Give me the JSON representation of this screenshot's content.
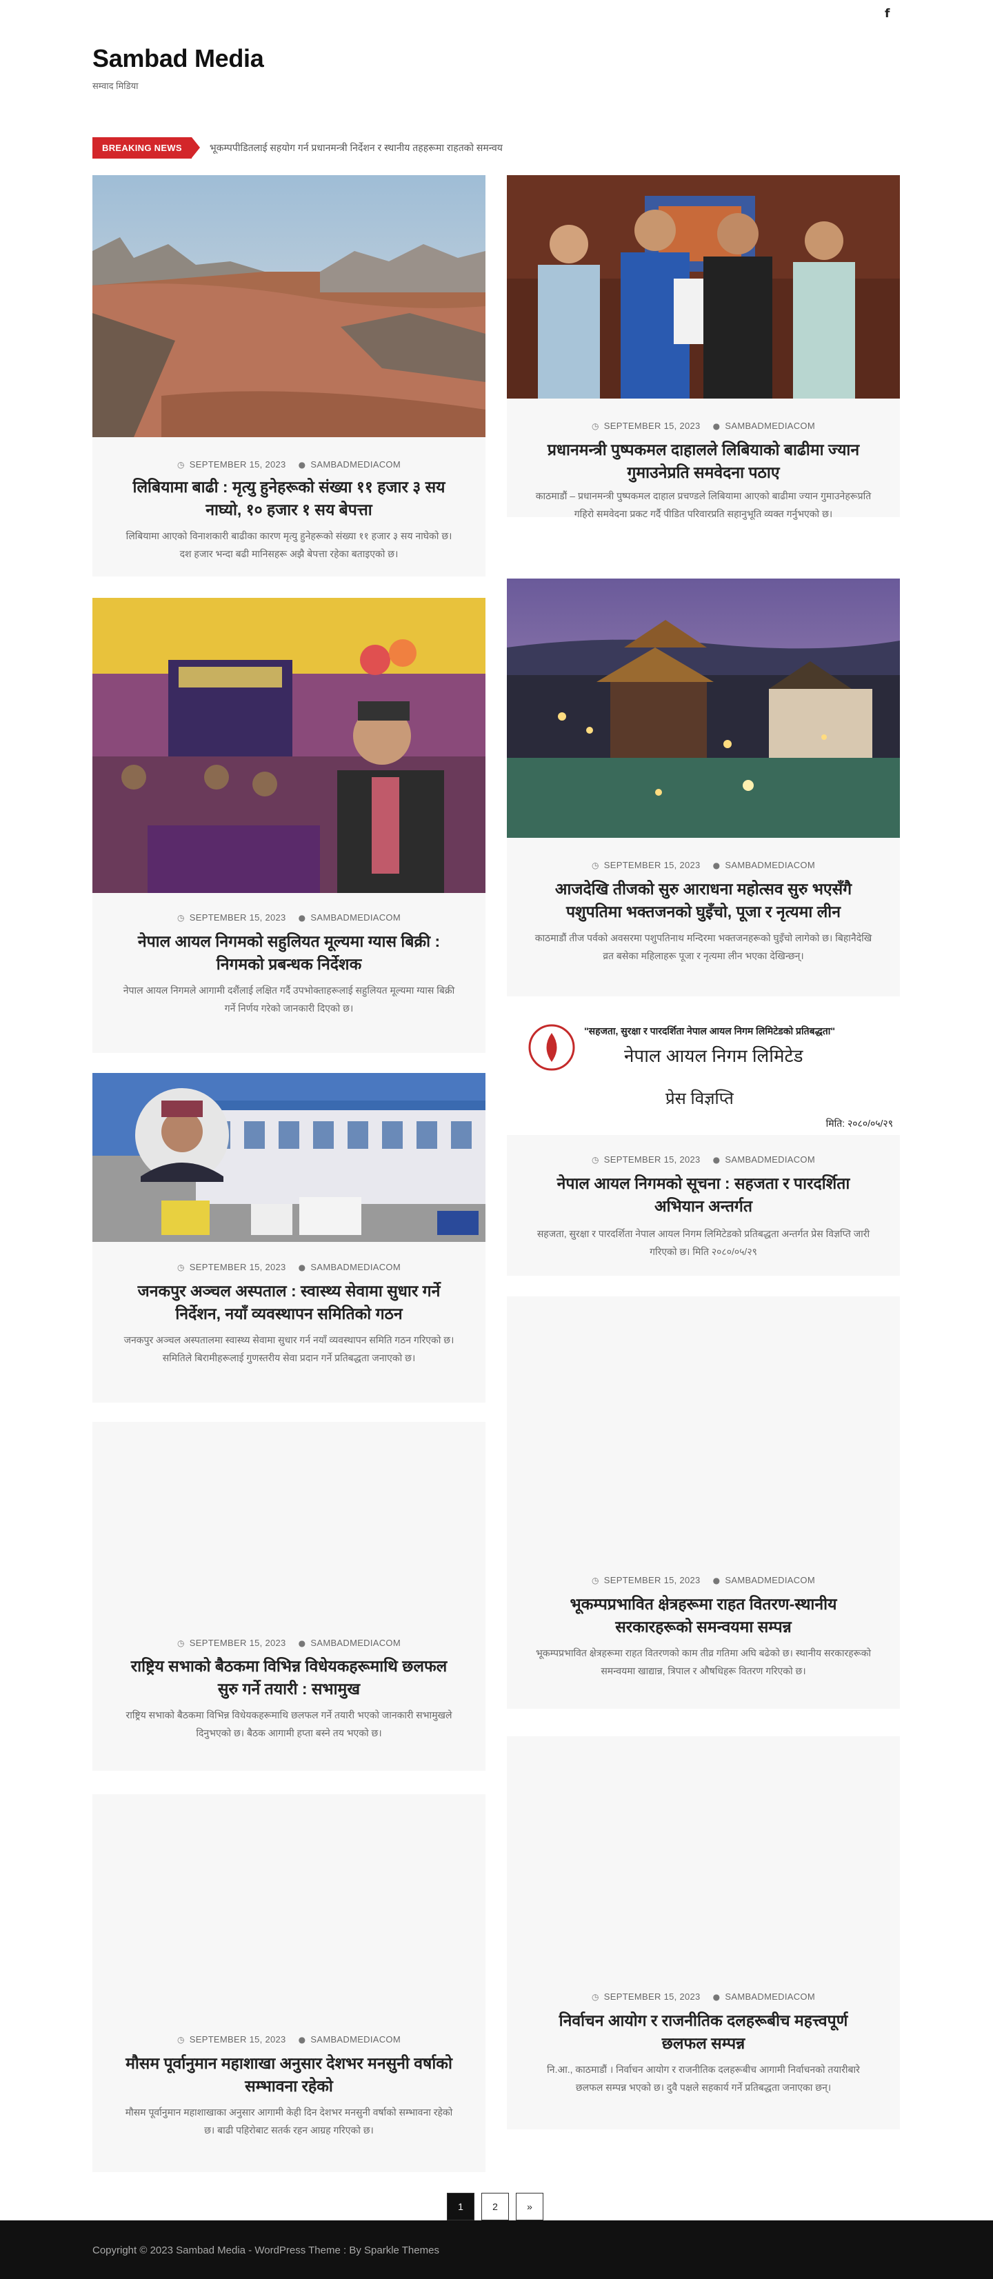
{
  "header": {
    "social_icon": "facebook-icon",
    "social_glyph": "f",
    "site_title": "Sambad Media",
    "tagline": "सम्वाद मिडिया"
  },
  "ticker": {
    "label": "BREAKING NEWS",
    "text": "भूकम्पपीडितलाई सहयोग गर्न प्रधानमन्त्री निर्देशन र स्थानीय तहहरूमा राहतको समन्वय"
  },
  "posts": [
    {
      "date": "SEPTEMBER 15, 2023",
      "author": "SAMBADMEDIACOM",
      "title": "लिबियामा बाढी : मृत्यु हुनेहरूको संख्या ११ हजार ३ सय नाघ्यो, १० हजार १ सय बेपत्ता",
      "excerpt": "लिबियामा आएको विनाशकारी बाढीका कारण मृत्यु हुनेहरूको संख्या ११ हजार ३ सय नाघेको छ। दश हजार भन्दा बढी मानिसहरू अझै बेपत्ता रहेका बताइएको छ।"
    },
    {
      "date": "SEPTEMBER 15, 2023",
      "author": "SAMBADMEDIACOM",
      "title": "प्रधानमन्त्री पुष्पकमल दाहालले लिबियाको बाढीमा ज्यान गुमाउनेप्रति समवेदना पठाए",
      "excerpt": "काठमाडौं – प्रधानमन्त्री पुष्पकमल दाहाल प्रचण्डले लिबियामा आएको बाढीमा ज्यान गुमाउनेहरूप्रति गहिरो समवेदना प्रकट गर्दै पीडित परिवारप्रति सहानुभूति व्यक्त गर्नुभएको छ।"
    },
    {
      "date": "SEPTEMBER 15, 2023",
      "author": "SAMBADMEDIACOM",
      "title": "नेपाल आयल निगमको सहुलियत मूल्यमा ग्यास बिक्री : निगमको प्रबन्धक निर्देशक",
      "excerpt": "नेपाल आयल निगमले आगामी दशैंलाई लक्षित गर्दै उपभोक्ताहरूलाई सहुलियत मूल्यमा ग्यास बिक्री गर्ने निर्णय गरेको जानकारी दिएको छ।"
    },
    {
      "date": "SEPTEMBER 15, 2023",
      "author": "SAMBADMEDIACOM",
      "title": "आजदेखि तीजको सुरु आराधना महोत्सव सुरु भएसँगै पशुपतिमा भक्तजनको घुइँचो, पूजा र नृत्यमा लीन",
      "excerpt": "काठमाडौं तीज पर्वको अवसरमा पशुपतिनाथ मन्दिरमा भक्तजनहरूको घुइँचो लागेको छ। बिहानैदेखि व्रत बसेका महिलाहरू पूजा र नृत्यमा लीन भएका देखिन्छन्।"
    },
    {
      "date": "SEPTEMBER 15, 2023",
      "author": "SAMBADMEDIACOM",
      "title": "नेपाल आयल निगमको सूचना : सहजता र पारदर्शिता अभियान अन्तर्गत",
      "excerpt": "सहजता, सुरक्षा र पारदर्शिता नेपाल आयल निगम लिमिटेडको प्रतिबद्धता अन्तर्गत प्रेस विज्ञप्ति जारी गरिएको छ। मिति २०८०/०५/२९"
    },
    {
      "date": "SEPTEMBER 15, 2023",
      "author": "SAMBADMEDIACOM",
      "title": "जनकपुर अञ्चल अस्पताल : स्वास्थ्य सेवामा सुधार गर्ने निर्देशन, नयाँ व्यवस्थापन समितिको गठन",
      "excerpt": "जनकपुर अञ्चल अस्पतालमा स्वास्थ्य सेवामा सुधार गर्न नयाँ व्यवस्थापन समिति गठन गरिएको छ। समितिले बिरामीहरूलाई गुणस्तरीय सेवा प्रदान गर्ने प्रतिबद्धता जनाएको छ।"
    },
    {
      "date": "SEPTEMBER 15, 2023",
      "author": "SAMBADMEDIACOM",
      "title": "भूकम्पप्रभावित क्षेत्रहरूमा राहत वितरण-स्थानीय सरकारहरूको समन्वयमा सम्पन्न",
      "excerpt": "भूकम्पप्रभावित क्षेत्रहरूमा राहत वितरणको काम तीव्र गतिमा अघि बढेको छ। स्थानीय सरकारहरूको समन्वयमा खाद्यान्न, त्रिपाल र औषधिहरू वितरण गरिएको छ।"
    },
    {
      "date": "SEPTEMBER 15, 2023",
      "author": "SAMBADMEDIACOM",
      "title": "राष्ट्रिय सभाको बैठकमा विभिन्न विधेयकहरूमाथि छलफल सुरु गर्ने तयारी : सभामुख",
      "excerpt": "राष्ट्रिय सभाको बैठकमा विभिन्न विधेयकहरूमाथि छलफल गर्ने तयारी भएको जानकारी सभामुखले दिनुभएको छ। बैठक आगामी हप्ता बस्ने तय भएको छ।"
    },
    {
      "date": "SEPTEMBER 15, 2023",
      "author": "SAMBADMEDIACOM",
      "title": "मौसम पूर्वानुमान महाशाखा अनुसार देशभर मनसुनी वर्षाको सम्भावना रहेको",
      "excerpt": "मौसम पूर्वानुमान महाशाखाका अनुसार आगामी केही दिन देशभर मनसुनी वर्षाको सम्भावना रहेको छ। बाढी पहिरोबाट सतर्क रहन आग्रह गरिएको छ।"
    },
    {
      "date": "SEPTEMBER 15, 2023",
      "author": "SAMBADMEDIACOM",
      "title": "निर्वाचन आयोग र राजनीतिक दलहरूबीच महत्त्वपूर्ण छलफल सम्पन्न",
      "excerpt": "नि.आ., काठमाडौं । निर्वाचन आयोग र राजनीतिक दलहरूबीच आगामी निर्वाचनको तयारीबारे छलफल सम्पन्न भएको छ। दुवै पक्षले सहकार्य गर्ने प्रतिबद्धता जनाएका छन्।"
    }
  ],
  "notice_image": {
    "slogan": "\"सहजता, सुरक्षा र पारदर्शिता नेपाल आयल निगम लिमिटेडको प्रतिबद्धता\"",
    "org": "नेपाल आयल निगम लिमिटेड",
    "doc": "प्रेस विज्ञप्ति",
    "date": "मिति: २०८०/०५/२९"
  },
  "pagination": {
    "pages": [
      "1",
      "2"
    ],
    "next": "»",
    "active": "1"
  },
  "footer": {
    "text": "Copyright © 2023 Sambad Media - WordPress Theme : By Sparkle Themes"
  },
  "colors": {
    "accent": "#d3262a",
    "card_bg": "#f7f7f7",
    "footer_bg": "#111111"
  }
}
